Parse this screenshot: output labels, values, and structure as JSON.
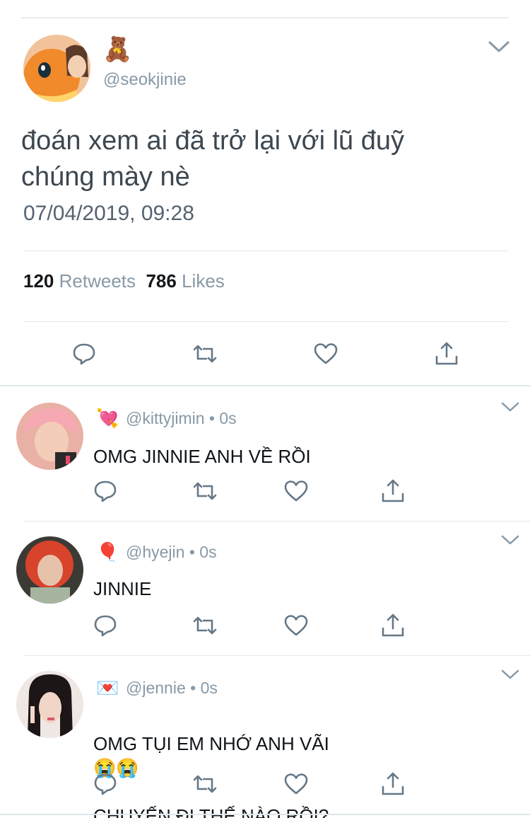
{
  "main_tweet": {
    "display_emoji": "🧸",
    "handle": "@seokjinie",
    "text": "đoán xem ai đã trở lại với lũ đuỹ\nchúng mày nè",
    "timestamp": "07/04/2019, 09:28",
    "retweets_count": "120",
    "retweets_label": "Retweets",
    "likes_count": "786",
    "likes_label": "Likes"
  },
  "replies": [
    {
      "emoji": "💘",
      "handle": "@kittyjimin",
      "separator": "•",
      "time": "0s",
      "text": "OMG JINNIE ANH VỀ RỒI"
    },
    {
      "emoji": "🎈",
      "handle": "@hyejin",
      "separator": "•",
      "time": "0s",
      "text": "JINNIE"
    },
    {
      "emoji": "💌",
      "handle": "@jennie",
      "separator": "•",
      "time": "0s",
      "text_line1": "OMG TỤI EM NHỚ ANH VÃI",
      "text_emoji": "😭😭",
      "text_line2": "CHUYẾN ĐI THẾ NÀO RỒI?"
    }
  ],
  "colors": {
    "icon_gray": "#657786",
    "divider": "#e6ecf0",
    "muted_text": "#8899a6"
  },
  "icons": [
    "reply-icon",
    "retweet-icon",
    "like-icon",
    "share-icon",
    "chevron-down-icon"
  ]
}
